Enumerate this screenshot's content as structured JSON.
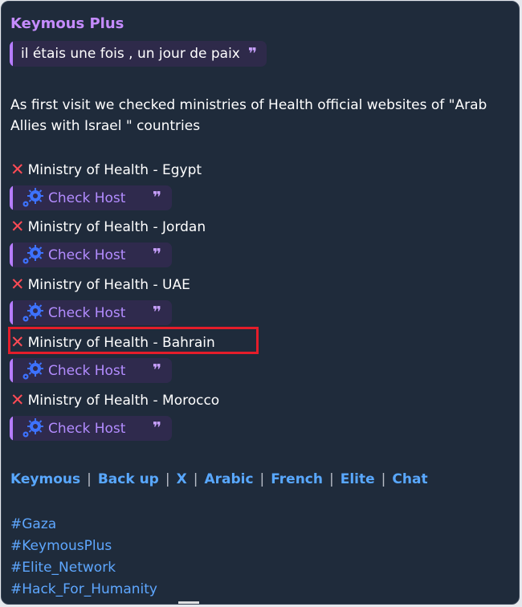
{
  "message": {
    "sender": "Keymous Plus",
    "quote_text": "il étais une fois , un jour de paix",
    "quote_mark": "❞",
    "paragraph": "As first visit we checked ministries of Health official websites of \"Arab Allies with Israel \" countries",
    "items": [
      {
        "icon": "red-x-icon",
        "label": "Ministry of Health - Egypt",
        "check_label": "Check Host"
      },
      {
        "icon": "red-x-icon",
        "label": "Ministry of Health - Jordan",
        "check_label": "Check Host"
      },
      {
        "icon": "red-x-icon",
        "label": "Ministry of Health - UAE",
        "check_label": "Check Host"
      },
      {
        "icon": "red-x-icon",
        "label": "Ministry of Health - Bahrain",
        "check_label": "Check Host"
      },
      {
        "icon": "red-x-icon",
        "label": "Ministry of Health - Morocco",
        "check_label": "Check Host"
      }
    ],
    "links": [
      "Keymous",
      "Back up",
      "X",
      "Arabic",
      "French",
      "Elite",
      "Chat"
    ],
    "separator": "|",
    "hashtags": [
      "#Gaza",
      "#KeymousPlus",
      "#Elite_Network",
      "#Hack_For_Humanity"
    ]
  },
  "colors": {
    "background": "#1f2b3b",
    "sender": "#c58cff",
    "quote_bg": "#2e2a4a",
    "accent": "#b67cff",
    "link": "#59a8ff",
    "highlight": "#e41d2a",
    "x_icon": "#ff4b55"
  }
}
